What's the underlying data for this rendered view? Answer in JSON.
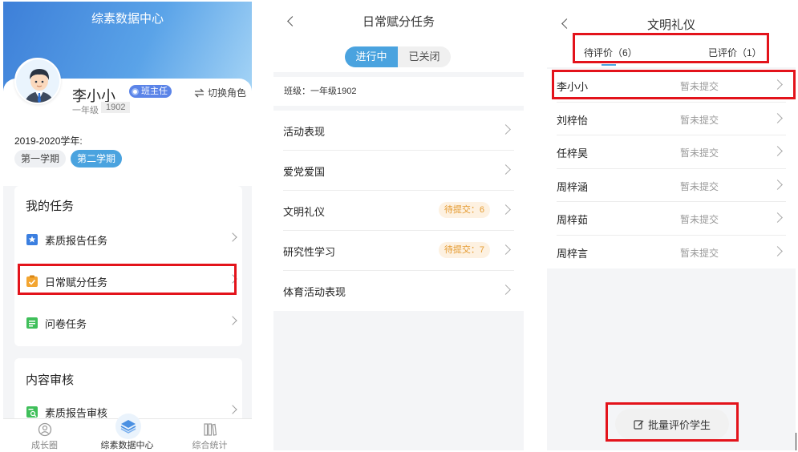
{
  "panel1": {
    "title": "综素数据中心",
    "user": {
      "name": "李小小",
      "role": "班主任",
      "grade": "一年级",
      "class_no": "1902"
    },
    "switch_role": "切换角色",
    "school_year": "2019-2020学年:",
    "terms": [
      "第一学期",
      "第二学期"
    ],
    "active_term": "第二学期",
    "my_tasks": {
      "title": "我的任务",
      "items": [
        "素质报告任务",
        "日常赋分任务",
        "问卷任务"
      ]
    },
    "content_review": {
      "title": "内容审核",
      "items": [
        "素质报告审核"
      ]
    },
    "tabbar": [
      "成长圈",
      "综素数据中心",
      "综合统计"
    ],
    "active_tab": "综素数据中心"
  },
  "panel2": {
    "title": "日常赋分任务",
    "segments": [
      "进行中",
      "已关闭"
    ],
    "active_segment": "进行中",
    "class_label": "班级：一年级1902",
    "tasks": [
      {
        "label": "活动表现",
        "pending": ""
      },
      {
        "label": "爱党爱国",
        "pending": ""
      },
      {
        "label": "文明礼仪",
        "pending": "待提交：6"
      },
      {
        "label": "研究性学习",
        "pending": "待提交：7"
      },
      {
        "label": "体育活动表现",
        "pending": ""
      }
    ]
  },
  "panel3": {
    "title": "文明礼仪",
    "tabs": [
      "待评价（6）",
      "已评价（1）"
    ],
    "active_tab": "待评价（6）",
    "students": [
      {
        "name": "李小小",
        "status": "暂未提交"
      },
      {
        "name": "刘梓怡",
        "status": "暂未提交"
      },
      {
        "name": "任梓昊",
        "status": "暂未提交"
      },
      {
        "name": "周梓涵",
        "status": "暂未提交"
      },
      {
        "name": "周梓茹",
        "status": "暂未提交"
      },
      {
        "name": "周梓言",
        "status": "暂未提交"
      }
    ],
    "batch_button": "批量评价学生"
  },
  "colors": {
    "accent": "#4aa3df",
    "highlight_box": "#e3131b",
    "pending_text": "#e49a2f",
    "pending_bg": "#fdf1e1"
  }
}
